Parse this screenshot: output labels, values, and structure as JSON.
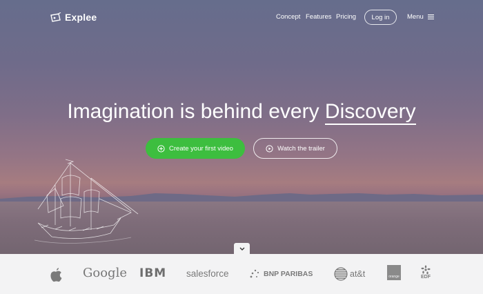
{
  "brand": {
    "name": "Explee"
  },
  "nav": {
    "links": [
      "Concept",
      "Features",
      "Pricing"
    ],
    "login": "Log in",
    "menu": "Menu",
    "menu_icon": "hamburger-icon"
  },
  "hero": {
    "headline_prefix": "Imagination is behind every",
    "headline_highlight": "Discovery",
    "primary_cta": {
      "label": "Create your first video",
      "icon": "plus-circle-icon",
      "color": "#3dbe3f"
    },
    "secondary_cta": {
      "label": "Watch the trailer",
      "icon": "play-circle-icon"
    },
    "scroll_icon": "chevron-down-icon"
  },
  "clients": {
    "google": "Google",
    "ibm": "IBM",
    "salesforce": "salesforce",
    "bnp": "BNP PARIBAS",
    "att": "at&t",
    "orange": "orange",
    "edf": "EDF"
  }
}
